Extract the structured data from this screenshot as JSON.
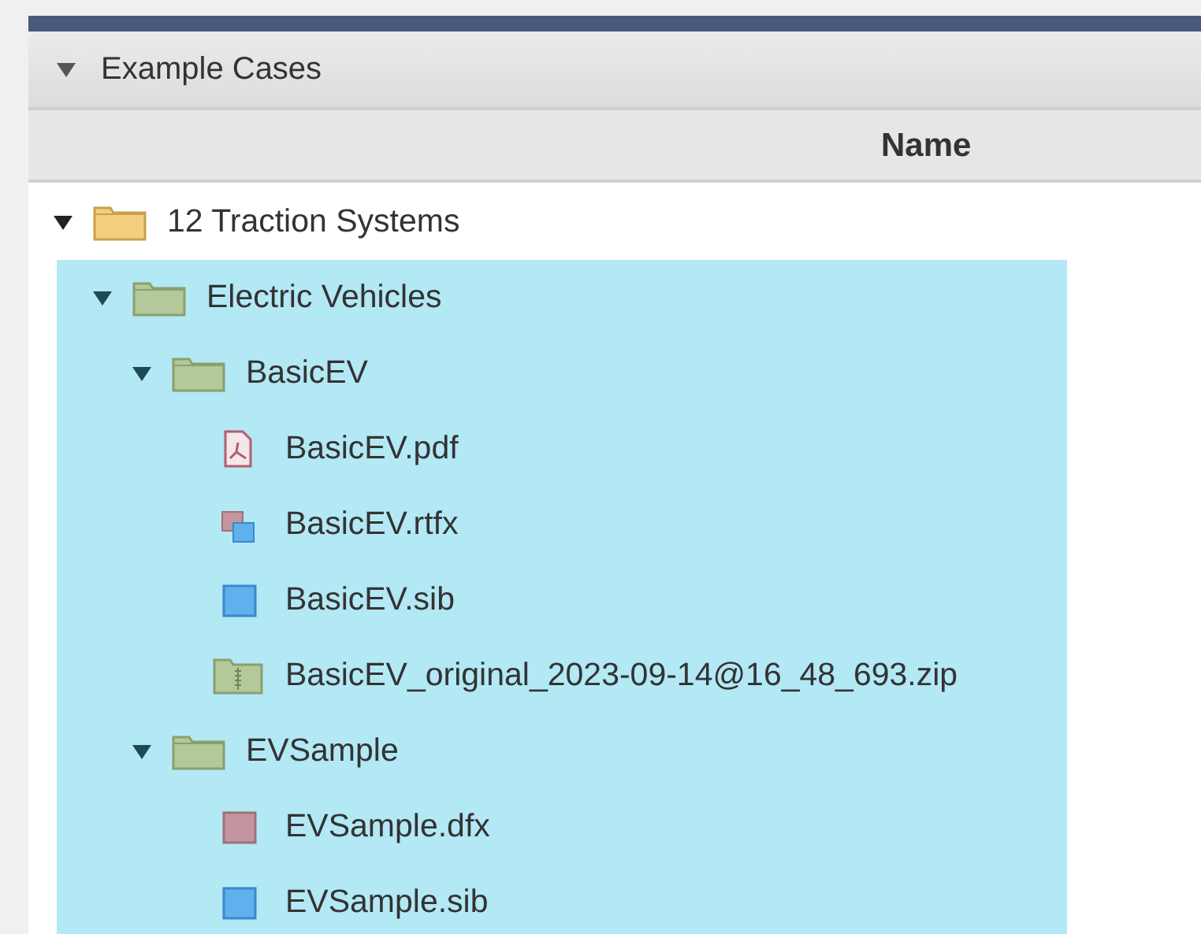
{
  "section": {
    "title": "Example Cases",
    "expanded": true
  },
  "table": {
    "columns": [
      "Name"
    ]
  },
  "tree": [
    {
      "label": "12 Traction Systems",
      "kind": "folder",
      "expanded": true,
      "selected": false,
      "children": [
        {
          "label": "Electric Vehicles",
          "kind": "folder",
          "expanded": true,
          "selected": true,
          "children": [
            {
              "label": "BasicEV",
              "kind": "folder",
              "expanded": true,
              "selected": true,
              "children": [
                {
                  "label": "BasicEV.pdf",
                  "kind": "pdf",
                  "selected": true
                },
                {
                  "label": "BasicEV.rtfx",
                  "kind": "rtfx",
                  "selected": true
                },
                {
                  "label": "BasicEV.sib",
                  "kind": "sib",
                  "selected": true
                },
                {
                  "label": "BasicEV_original_2023-09-14@16_48_693.zip",
                  "kind": "zip",
                  "selected": true
                }
              ]
            },
            {
              "label": "EVSample",
              "kind": "folder",
              "expanded": true,
              "selected": true,
              "children": [
                {
                  "label": "EVSample.dfx",
                  "kind": "dfx",
                  "selected": true
                },
                {
                  "label": "EVSample.sib",
                  "kind": "sib",
                  "selected": true
                }
              ]
            }
          ]
        }
      ]
    }
  ]
}
